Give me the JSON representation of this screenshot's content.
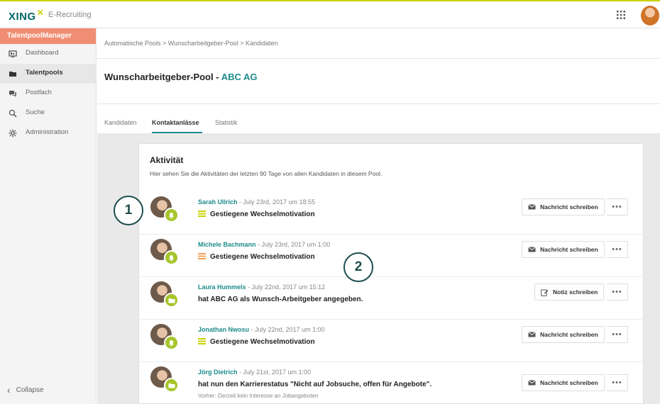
{
  "header": {
    "logo": "XING",
    "product": "E-Recruiting"
  },
  "sidebar": {
    "title": "TalentpoolManager",
    "items": [
      {
        "label": "Dashboard",
        "icon": "dashboard-icon"
      },
      {
        "label": "Talentpools",
        "icon": "folder-icon",
        "active": true
      },
      {
        "label": "Postfach",
        "icon": "chat-icon"
      },
      {
        "label": "Suche",
        "icon": "search-icon"
      },
      {
        "label": "Administration",
        "icon": "gear-icon"
      }
    ],
    "collapse_label": "Collapse"
  },
  "breadcrumb": "Automatische Pools > Wunscharbeitgeber-Pool > Kandidaten",
  "page": {
    "title_prefix": "Wunscharbeitgeber-Pool - ",
    "company": "ABC AG"
  },
  "tabs": [
    {
      "label": "Kandidaten"
    },
    {
      "label": "Kontaktanlässe",
      "active": true
    },
    {
      "label": "Statistik"
    }
  ],
  "activity": {
    "title": "Aktivität",
    "subtitle": "Hier sehen Sie die Aktivitäten der letzten 90 Tage von allen Kandidaten in diesem Pool.",
    "rows": [
      {
        "name": "Sarah Ullrich",
        "date": " - July 23rd, 2017 um 18:55",
        "action": "Gestiegene Wechselmotivation",
        "action_icon": "lines-green",
        "badge_icon": "bell-icon",
        "button": "Nachricht schreiben",
        "button_icon": "envelope-icon",
        "sub": ""
      },
      {
        "name": "Michele Bachmann",
        "date": " - July 23rd, 2017 um 1:00",
        "action": "Gestiegene Wechselmotivation",
        "action_icon": "lines-orange",
        "badge_icon": "bell-icon",
        "button": "Nachricht schreiben",
        "button_icon": "envelope-icon",
        "sub": ""
      },
      {
        "name": "Laura Hummels",
        "date": " - July 22nd, 2017 um 15:12",
        "action": "hat ABC AG als Wunsch-Arbeitgeber angegeben.",
        "action_icon": "",
        "badge_icon": "folder-icon",
        "button": "Notiz schreiben",
        "button_icon": "edit-icon",
        "sub": ""
      },
      {
        "name": "Jonathan Nwosu",
        "date": " - July 22nd, 2017 um 1:00",
        "action": "Gestiegene Wechselmotivation",
        "action_icon": "lines-green",
        "badge_icon": "bell-icon",
        "button": "Nachricht schreiben",
        "button_icon": "envelope-icon",
        "sub": ""
      },
      {
        "name": "Jörg Dietrich",
        "date": " - July 21st, 2017 um 1:00",
        "action": "hat nun den Karrierestatus \"Nicht auf Jobsuche, offen für Angebote\".",
        "action_icon": "",
        "badge_icon": "folder-icon",
        "button": "Nachricht schreiben",
        "button_icon": "envelope-icon",
        "sub": "Vorher: Derzeit kein Interesse an Jobangeboten"
      }
    ],
    "more_label": "•••"
  },
  "callouts": [
    "1",
    "2"
  ],
  "colors": {
    "accent": "#1e8c8c",
    "brand_lime": "#c9d200",
    "sidebar_header": "#f08d73",
    "badge": "#a7c42b"
  }
}
